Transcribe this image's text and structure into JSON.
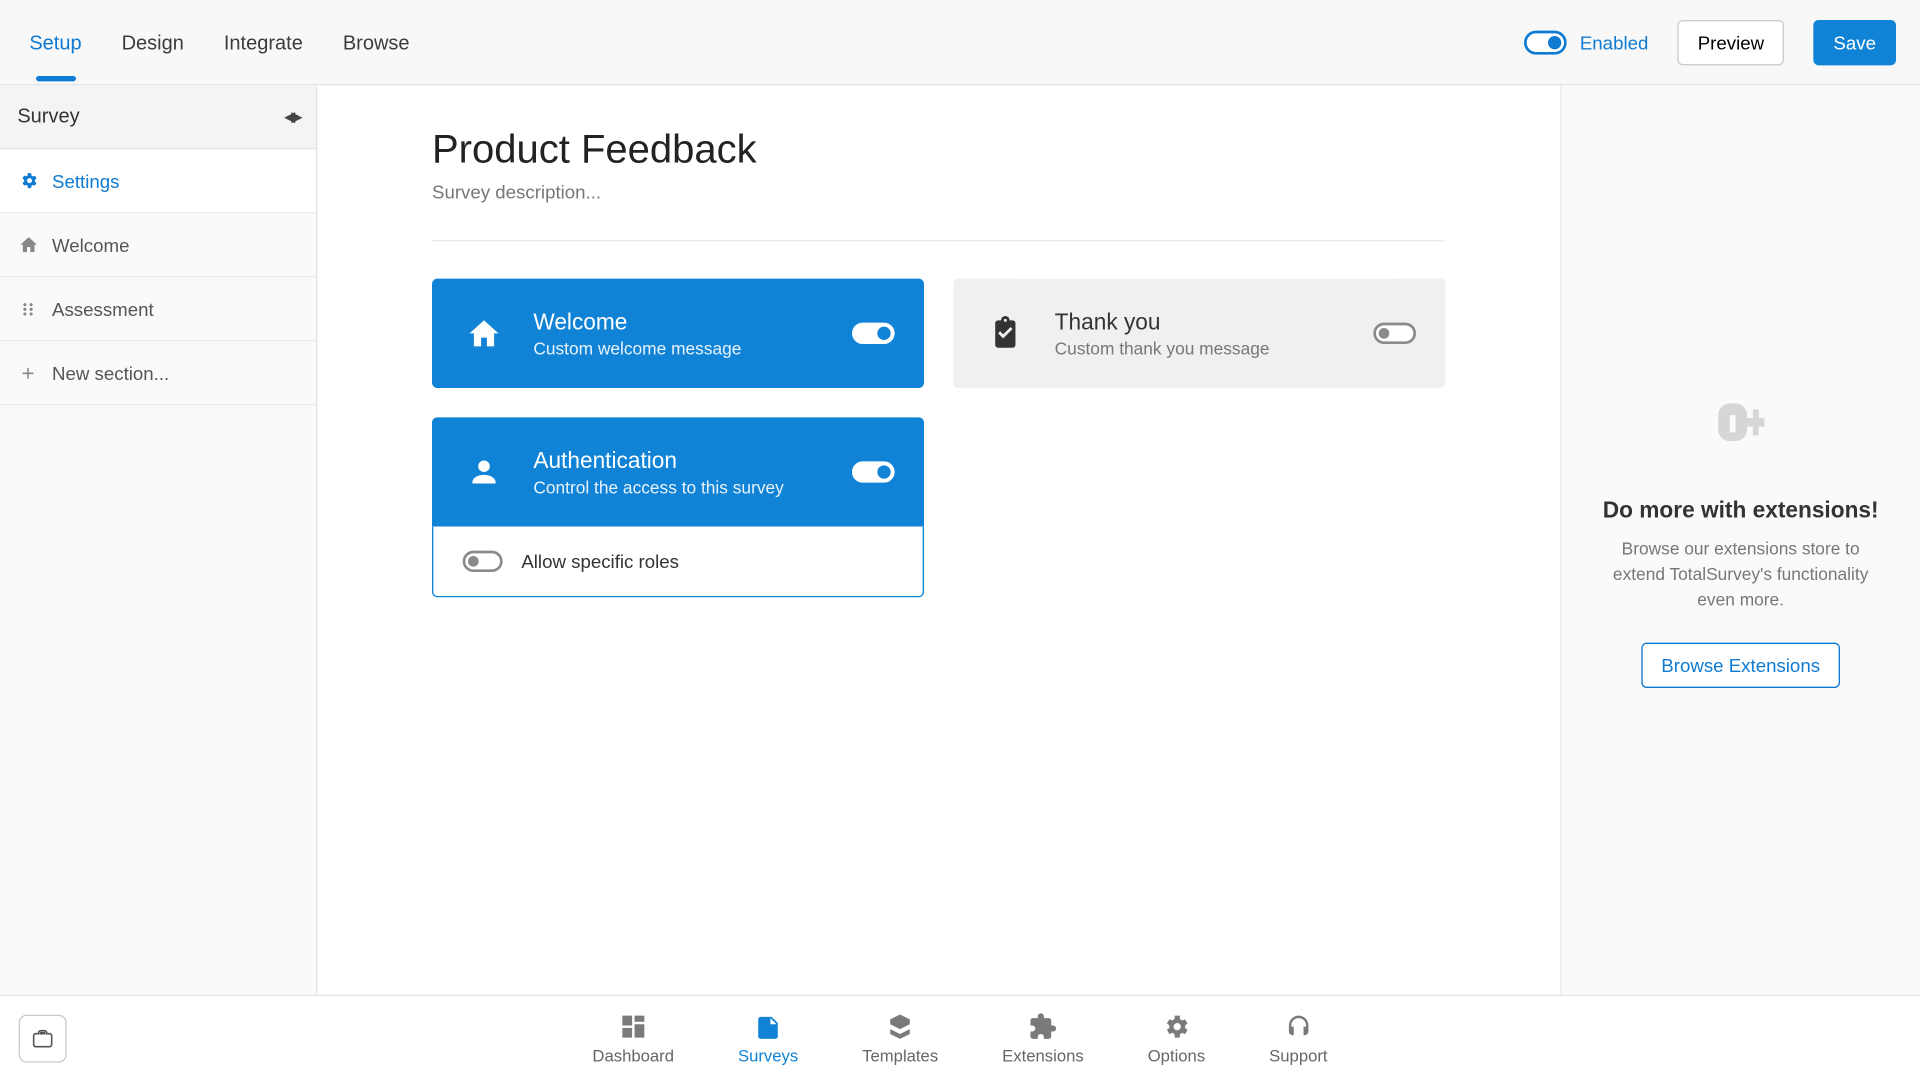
{
  "topbar": {
    "tabs": [
      "Setup",
      "Design",
      "Integrate",
      "Browse"
    ],
    "enabled_label": "Enabled",
    "preview_label": "Preview",
    "save_label": "Save"
  },
  "sidebar": {
    "header": "Survey",
    "items": [
      {
        "label": "Settings"
      },
      {
        "label": "Welcome"
      },
      {
        "label": "Assessment"
      },
      {
        "label": "New section..."
      }
    ]
  },
  "main": {
    "title": "Product Feedback",
    "description": "Survey description...",
    "cards": {
      "welcome": {
        "title": "Welcome",
        "subtitle": "Custom welcome message"
      },
      "thankyou": {
        "title": "Thank you",
        "subtitle": "Custom thank you message"
      },
      "auth": {
        "title": "Authentication",
        "subtitle": "Control the access to this survey",
        "option_roles": "Allow specific roles"
      }
    }
  },
  "rpanel": {
    "title": "Do more with extensions!",
    "body": "Browse our extensions store to extend TotalSurvey's functionality even more.",
    "button": "Browse Extensions"
  },
  "bottombar": {
    "items": [
      "Dashboard",
      "Surveys",
      "Templates",
      "Extensions",
      "Options",
      "Support"
    ]
  }
}
